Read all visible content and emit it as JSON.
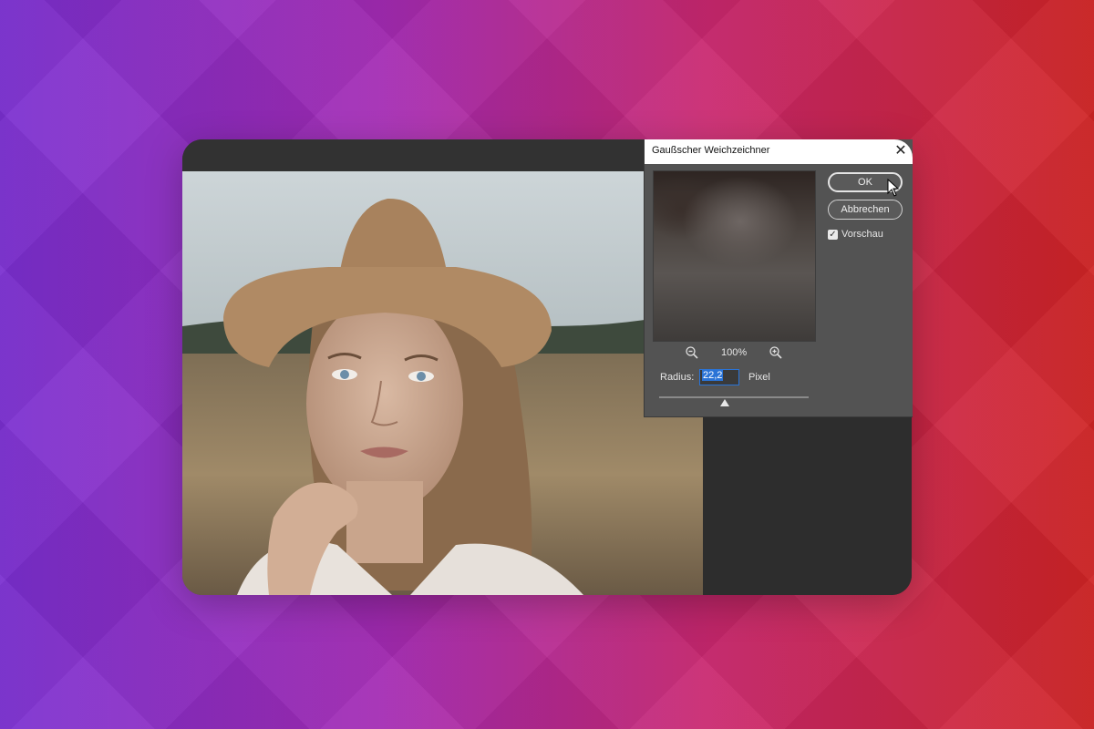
{
  "dialog": {
    "title": "Gaußscher Weichzeichner",
    "close_icon": "close-icon",
    "ok_label": "OK",
    "cancel_label": "Abbrechen",
    "preview_label": "Vorschau",
    "preview_checked": true,
    "zoom": "100%",
    "radius_label": "Radius:",
    "radius_value": "22,2",
    "unit_label": "Pixel",
    "slider_fraction": 0.44
  },
  "colors": {
    "accent": "#2a73d6",
    "dialog_bg": "#535353",
    "canvas_bg": "#2d2d2d"
  }
}
